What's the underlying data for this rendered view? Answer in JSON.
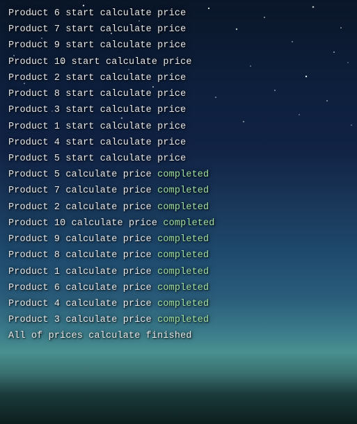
{
  "log": {
    "lines": [
      {
        "text": "Product 6 start calculate price",
        "suffix": "",
        "type": "start"
      },
      {
        "text": "Product 7 start calculate price",
        "suffix": "",
        "type": "start"
      },
      {
        "text": "Product 9 start calculate price",
        "suffix": "",
        "type": "start"
      },
      {
        "text": "Product 10 start calculate price",
        "suffix": "",
        "type": "start"
      },
      {
        "text": "Product 2 start calculate price",
        "suffix": "",
        "type": "start"
      },
      {
        "text": "Product 8 start calculate price",
        "suffix": "",
        "type": "start"
      },
      {
        "text": "Product 3 start calculate price",
        "suffix": "",
        "type": "start"
      },
      {
        "text": "Product 1 start calculate price",
        "suffix": "",
        "type": "start"
      },
      {
        "text": "Product 4 start calculate price",
        "suffix": "",
        "type": "start"
      },
      {
        "text": "Product 5 start calculate price",
        "suffix": "",
        "type": "start"
      },
      {
        "text": "Product 5 calculate price ",
        "suffix": "completed",
        "type": "completed"
      },
      {
        "text": "Product 7 calculate price ",
        "suffix": "completed",
        "type": "completed"
      },
      {
        "text": "Product 2 calculate price ",
        "suffix": "completed",
        "type": "completed"
      },
      {
        "text": "Product 10 calculate price ",
        "suffix": "completed",
        "type": "completed"
      },
      {
        "text": "Product 9 calculate price ",
        "suffix": "completed",
        "type": "completed"
      },
      {
        "text": "Product 8 calculate price ",
        "suffix": "completed",
        "type": "completed"
      },
      {
        "text": "Product 1 calculate price ",
        "suffix": "completed",
        "type": "completed"
      },
      {
        "text": "Product 6 calculate price ",
        "suffix": "completed",
        "type": "completed"
      },
      {
        "text": "Product 4 calculate price ",
        "suffix": "completed",
        "type": "completed"
      },
      {
        "text": "Product 3 calculate price ",
        "suffix": "completed",
        "type": "completed"
      },
      {
        "text": "All of prices calculate finished",
        "suffix": "",
        "type": "finished"
      }
    ]
  }
}
